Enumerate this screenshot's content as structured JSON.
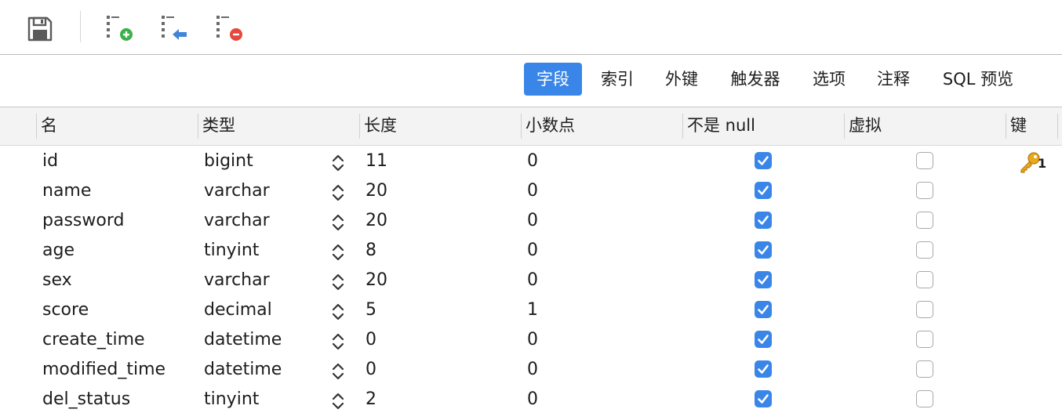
{
  "toolbar": {
    "buttons": [
      {
        "name": "save-button",
        "icon": "floppy-disk-icon"
      },
      {
        "name": "add-field-button",
        "icon": "field-add-icon"
      },
      {
        "name": "insert-field-button",
        "icon": "field-insert-icon"
      },
      {
        "name": "delete-field-button",
        "icon": "field-delete-icon"
      }
    ]
  },
  "tabs": [
    {
      "label": "字段",
      "active": true
    },
    {
      "label": "索引",
      "active": false
    },
    {
      "label": "外键",
      "active": false
    },
    {
      "label": "触发器",
      "active": false
    },
    {
      "label": "选项",
      "active": false
    },
    {
      "label": "注释",
      "active": false
    },
    {
      "label": "SQL 预览",
      "active": false
    }
  ],
  "table": {
    "columns": [
      "名",
      "类型",
      "长度",
      "小数点",
      "不是 null",
      "虚拟",
      "键"
    ],
    "rows": [
      {
        "name": "id",
        "type": "bigint",
        "length": "11",
        "decimals": "0",
        "not_null": true,
        "virtual": false,
        "key": "1"
      },
      {
        "name": "name",
        "type": "varchar",
        "length": "20",
        "decimals": "0",
        "not_null": true,
        "virtual": false,
        "key": ""
      },
      {
        "name": "password",
        "type": "varchar",
        "length": "20",
        "decimals": "0",
        "not_null": true,
        "virtual": false,
        "key": ""
      },
      {
        "name": "age",
        "type": "tinyint",
        "length": "8",
        "decimals": "0",
        "not_null": true,
        "virtual": false,
        "key": ""
      },
      {
        "name": "sex",
        "type": "varchar",
        "length": "20",
        "decimals": "0",
        "not_null": true,
        "virtual": false,
        "key": ""
      },
      {
        "name": "score",
        "type": "decimal",
        "length": "5",
        "decimals": "1",
        "not_null": true,
        "virtual": false,
        "key": ""
      },
      {
        "name": "create_time",
        "type": "datetime",
        "length": "0",
        "decimals": "0",
        "not_null": true,
        "virtual": false,
        "key": ""
      },
      {
        "name": "modified_time",
        "type": "datetime",
        "length": "0",
        "decimals": "0",
        "not_null": true,
        "virtual": false,
        "key": ""
      },
      {
        "name": "del_status",
        "type": "tinyint",
        "length": "2",
        "decimals": "0",
        "not_null": true,
        "virtual": false,
        "key": ""
      }
    ]
  },
  "colors": {
    "accent": "#3a86e8",
    "key_gold": "#e9a81e",
    "add_green": "#3cb04a",
    "delete_red": "#e5483d",
    "insert_blue": "#3f86d8"
  }
}
